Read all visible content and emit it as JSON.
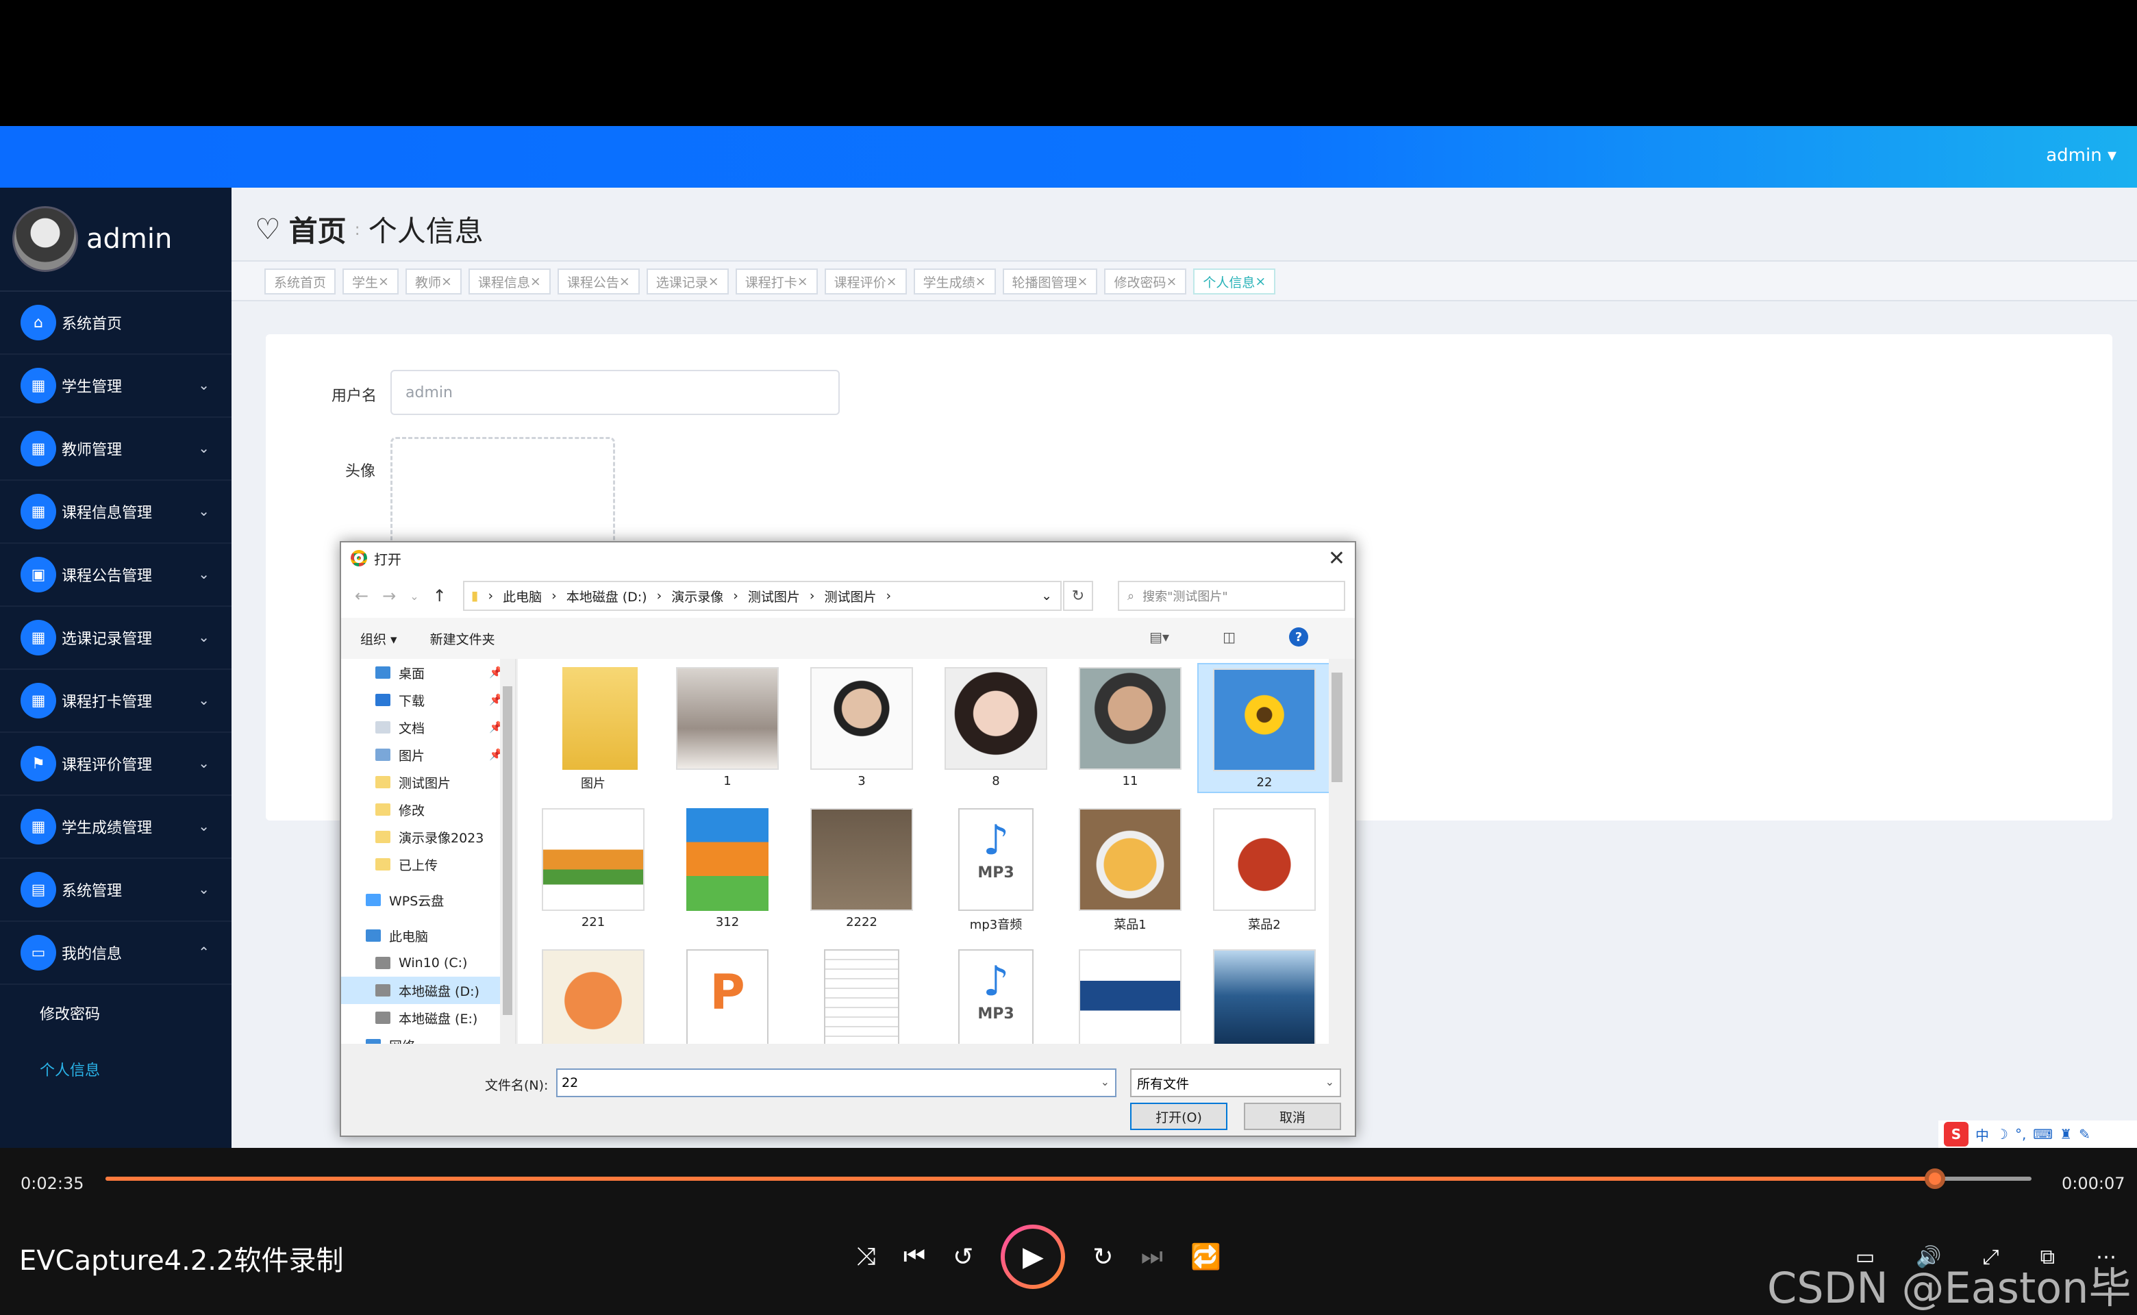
{
  "app": {
    "user": "admin"
  },
  "sidebar": {
    "title": "admin",
    "items": [
      {
        "label": "系统首页",
        "icon": "home-icon",
        "has_chevron": false
      },
      {
        "label": "学生管理",
        "icon": "grid-icon",
        "has_chevron": true
      },
      {
        "label": "教师管理",
        "icon": "grid-icon",
        "has_chevron": true
      },
      {
        "label": "课程信息管理",
        "icon": "grid-icon",
        "has_chevron": true
      },
      {
        "label": "课程公告管理",
        "icon": "clipboard-icon",
        "has_chevron": true
      },
      {
        "label": "选课记录管理",
        "icon": "grid-icon",
        "has_chevron": true
      },
      {
        "label": "课程打卡管理",
        "icon": "grid-icon",
        "has_chevron": true
      },
      {
        "label": "课程评价管理",
        "icon": "flag-icon",
        "has_chevron": true
      },
      {
        "label": "学生成绩管理",
        "icon": "grid-icon",
        "has_chevron": true
      },
      {
        "label": "系统管理",
        "icon": "briefcase-icon",
        "has_chevron": true
      },
      {
        "label": "我的信息",
        "icon": "id-card-icon",
        "has_chevron": true,
        "expanded": true
      }
    ],
    "subitems": [
      {
        "label": "修改密码",
        "active": false
      },
      {
        "label": "个人信息",
        "active": true
      }
    ]
  },
  "breadcrumb": {
    "home": "首页",
    "current": "个人信息"
  },
  "tabs": [
    {
      "label": "系统首页",
      "closable": false,
      "active": false
    },
    {
      "label": "学生",
      "closable": true,
      "active": false
    },
    {
      "label": "教师",
      "closable": true,
      "active": false
    },
    {
      "label": "课程信息",
      "closable": true,
      "active": false
    },
    {
      "label": "课程公告",
      "closable": true,
      "active": false
    },
    {
      "label": "选课记录",
      "closable": true,
      "active": false
    },
    {
      "label": "课程打卡",
      "closable": true,
      "active": false
    },
    {
      "label": "课程评价",
      "closable": true,
      "active": false
    },
    {
      "label": "学生成绩",
      "closable": true,
      "active": false
    },
    {
      "label": "轮播图管理",
      "closable": true,
      "active": false
    },
    {
      "label": "修改密码",
      "closable": true,
      "active": false
    },
    {
      "label": "个人信息",
      "closable": true,
      "active": true
    }
  ],
  "form": {
    "username_label": "用户名",
    "username_value": "admin",
    "avatar_label": "头像"
  },
  "dialog": {
    "title": "打开",
    "path": [
      "此电脑",
      "本地磁盘 (D:)",
      "演示录像",
      "测试图片",
      "测试图片"
    ],
    "search_placeholder": "搜索\"测试图片\"",
    "organize": "组织 ▾",
    "new_folder": "新建文件夹",
    "nav": [
      {
        "label": "桌面",
        "pinned": true,
        "kind": "desktop",
        "selected": false
      },
      {
        "label": "下载",
        "pinned": true,
        "kind": "download",
        "selected": false
      },
      {
        "label": "文档",
        "pinned": true,
        "kind": "doc",
        "selected": false
      },
      {
        "label": "图片",
        "pinned": true,
        "kind": "pic",
        "selected": false
      },
      {
        "label": "测试图片",
        "pinned": false,
        "kind": "folder",
        "selected": false
      },
      {
        "label": "修改",
        "pinned": false,
        "kind": "folder",
        "selected": false
      },
      {
        "label": "演示录像2023",
        "pinned": false,
        "kind": "folder",
        "selected": false
      },
      {
        "label": "已上传",
        "pinned": false,
        "kind": "folder",
        "selected": false
      },
      {
        "label": "WPS云盘",
        "pinned": false,
        "kind": "cloud",
        "selected": false
      },
      {
        "label": "此电脑",
        "pinned": false,
        "kind": "pc",
        "selected": false
      },
      {
        "label": "Win10 (C:)",
        "pinned": false,
        "kind": "drive",
        "selected": false
      },
      {
        "label": "本地磁盘 (D:)",
        "pinned": false,
        "kind": "drive",
        "selected": true
      },
      {
        "label": "本地磁盘 (E:)",
        "pinned": false,
        "kind": "drive",
        "selected": false
      },
      {
        "label": "网络",
        "pinned": false,
        "kind": "net",
        "selected": false
      }
    ],
    "files": [
      {
        "label": "图片",
        "kind": "folder",
        "selected": false
      },
      {
        "label": "1",
        "kind": "photo-girl",
        "selected": false
      },
      {
        "label": "3",
        "kind": "photo-man",
        "selected": false
      },
      {
        "label": "8",
        "kind": "photo-girl2",
        "selected": false
      },
      {
        "label": "11",
        "kind": "photo-man2",
        "selected": false
      },
      {
        "label": "22",
        "kind": "photo-sunflower",
        "selected": true
      },
      {
        "label": "221",
        "kind": "photo-food",
        "selected": false
      },
      {
        "label": "312",
        "kind": "archive",
        "selected": false
      },
      {
        "label": "2222",
        "kind": "photo-bottles",
        "selected": false
      },
      {
        "label": "mp3音频",
        "kind": "mp3",
        "selected": false
      },
      {
        "label": "菜品1",
        "kind": "photo-pie",
        "selected": false
      },
      {
        "label": "菜品2",
        "kind": "photo-crawfish",
        "selected": false
      },
      {
        "label": "",
        "kind": "photo-shrimp",
        "selected": false
      },
      {
        "label": "",
        "kind": "ppt",
        "selected": false
      },
      {
        "label": "",
        "kind": "doc",
        "selected": false
      },
      {
        "label": "",
        "kind": "mp3",
        "selected": false
      },
      {
        "label": "",
        "kind": "photo-plate",
        "selected": false
      },
      {
        "label": "",
        "kind": "photo-ocean",
        "selected": false
      }
    ],
    "filename_label": "文件名(N):",
    "filename_value": "22",
    "filetype": "所有文件",
    "open_button": "打开(O)",
    "cancel_button": "取消"
  },
  "player": {
    "elapsed": "0:02:35",
    "remaining": "0:00:07",
    "progress": 0.95,
    "title": "EVCapture4.2.2软件录制"
  },
  "watermark": "CSDN @Easton毕设",
  "ime": {
    "lang": "中"
  }
}
